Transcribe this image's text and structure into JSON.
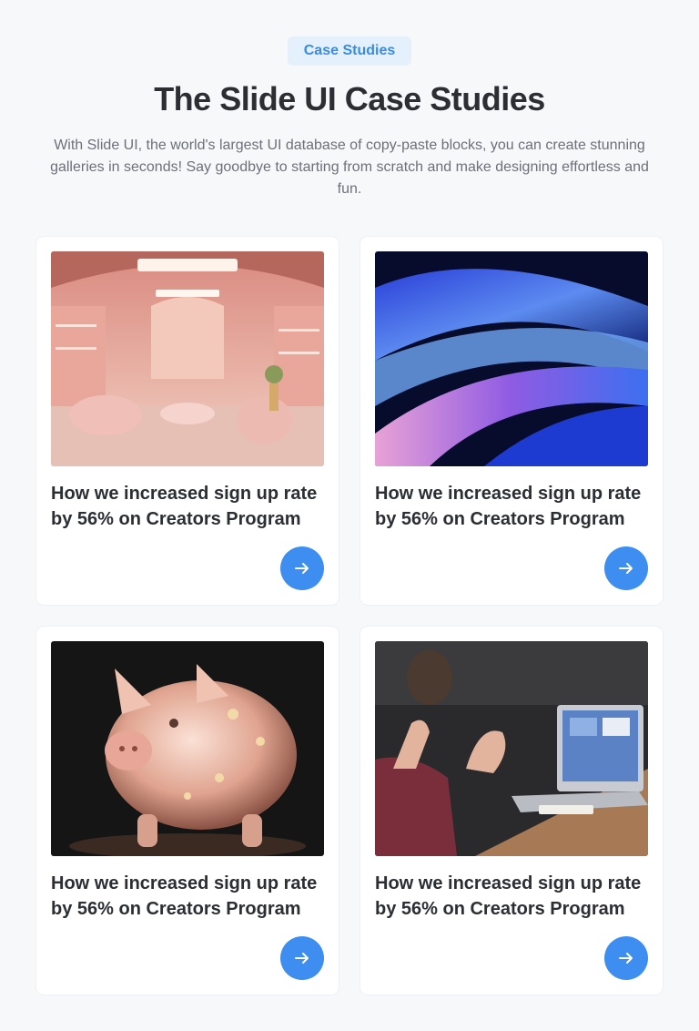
{
  "header": {
    "badge": "Case Studies",
    "title": "The Slide UI Case Studies",
    "description": "With Slide UI, the world's largest UI database of copy-paste blocks, you can create stunning galleries in seconds! Say goodbye to starting from scratch and make designing effortless and fun."
  },
  "cards": [
    {
      "heading": "How we increased sign up rate by 56% on Creators Program",
      "image": "pink-interior-image",
      "button_icon": "arrow-right-icon"
    },
    {
      "heading": "How we increased sign up rate by 56% on Creators Program",
      "image": "abstract-waves-image",
      "button_icon": "arrow-right-icon"
    },
    {
      "heading": "How we increased sign up rate by 56% on Creators Program",
      "image": "glass-piggy-bank-image",
      "button_icon": "arrow-right-icon"
    },
    {
      "heading": "How we increased sign up rate by 56% on Creators Program",
      "image": "meeting-laptop-image",
      "button_icon": "arrow-right-icon"
    }
  ],
  "colors": {
    "accent": "#3d8ef0",
    "badge_bg": "#e4f1fd",
    "badge_text": "#3b8be0",
    "page_bg": "#f7f8fa"
  }
}
